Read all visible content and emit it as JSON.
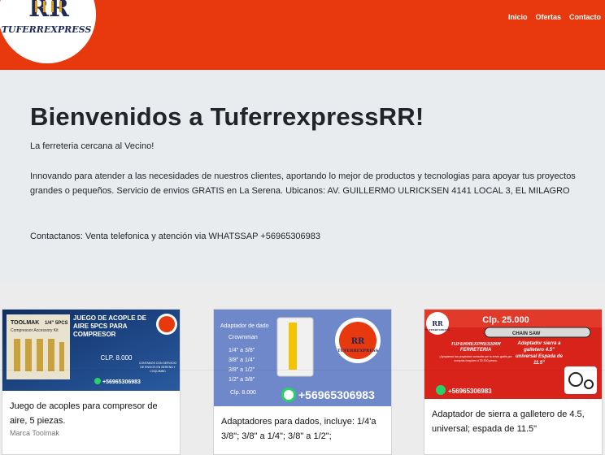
{
  "header": {
    "logo_text": "TUFERREXPRESS",
    "logo_mark": "RR",
    "nav": [
      "Inicio",
      "Ofertas",
      "Contacto"
    ]
  },
  "hero": {
    "title": "Bienvenidos a TuferrexpressRR!",
    "tagline": "La ferreteria cercana al Vecino!",
    "description": "Innovando para atender a las necesidades de nuestros clientes, aportando lo mejor de productos y tecnologias para apoyar tus proyectos grandes o pequeños. Servicio de envios GRATIS en La Serena. Ubicanos: AV. GUILLERMO ULRICKSEN 4141 LOCAL 3, EL MILAGRO",
    "contact": "Contactanos: Venta telefonica y atención via WHATSSAP +56965306983"
  },
  "products": [
    {
      "title": "Juego de acoples para compresor de aire, 5 piezas.",
      "brand": "Marca Toolmak",
      "image": {
        "brand": "TOOLMAK",
        "badge": "1/4\" 5PCS",
        "kit_name": "Compressor Accessory Kit",
        "headline": "JUEGO DE ACOPLE DE AIRE 5PCS PARA COMPRESOR",
        "price": "CLP. 8.000",
        "phone": "+56965306983",
        "note": "CONTAMOS CON SERVICIO DE ENVIOS EN SERENA Y COQUIMBO"
      }
    },
    {
      "title": "Adaptadores para dados, incluye: 1/4'a 3/8\"; 3/8\" a 1/4\"; 3/8\" a 1/2\";",
      "brand": "",
      "image": {
        "lines": [
          "Adaptador de dado",
          "Crowmman",
          "1/4\" a 3/8\"",
          "3/8\" a 1/4\"",
          "3/8\" a 1/2\"",
          "1/2\" a 3/8\""
        ],
        "price": "Clp. 8.000",
        "phone": "+56965306983",
        "logo_text": "TUFERREXPRESS"
      }
    },
    {
      "title": "Adaptador de sierra a galletero de 4.5, universal; espada de 11.5\"",
      "brand": "",
      "image": {
        "price": "Clp. 25.000",
        "store": "TUFERREXPRESSRR FERRETERIA",
        "promo": "¡Apoyamos tus proyectos! consulta por tu envio gratis por compras mayores a 30.000 pesos.",
        "product": "Adaptador sierra a galletero 4.5\" universal Espada de 11.5\"",
        "saw_label": "CHAIN SAW",
        "phone": "+56965306983",
        "logo_text": "TUFERREXPRESS"
      }
    }
  ]
}
